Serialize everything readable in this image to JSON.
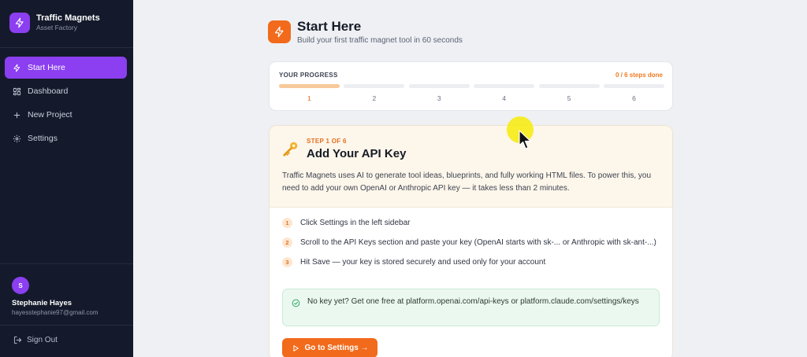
{
  "brand": {
    "name": "Traffic Magnets",
    "subtitle": "Asset Factory"
  },
  "sidebar": {
    "items": [
      {
        "label": "Start Here",
        "icon": "bolt-icon",
        "active": true
      },
      {
        "label": "Dashboard",
        "icon": "dashboard-icon",
        "active": false
      },
      {
        "label": "New Project",
        "icon": "plus-icon",
        "active": false
      },
      {
        "label": "Settings",
        "icon": "gear-icon",
        "active": false
      }
    ]
  },
  "user": {
    "initial": "S",
    "name": "Stephanie Hayes",
    "email": "hayesstephanie97@gmail.com",
    "signout_label": "Sign Out"
  },
  "header": {
    "title": "Start Here",
    "subtitle": "Build your first traffic magnet tool in 60 seconds"
  },
  "progress": {
    "label": "YOUR PROGRESS",
    "count": "0 / 6 steps done",
    "completed": 0,
    "total": 6,
    "current": 1,
    "steps": [
      "1",
      "2",
      "3",
      "4",
      "5",
      "6"
    ]
  },
  "step": {
    "kicker": "STEP 1 OF 6",
    "title": "Add Your API Key",
    "description": "Traffic Magnets uses AI to generate tool ideas, blueprints, and fully working HTML files. To power this, you need to add your own OpenAI or Anthropic API key — it takes less than 2 minutes.",
    "instructions": [
      {
        "num": "1",
        "text": "Click Settings in the left sidebar"
      },
      {
        "num": "2",
        "text": "Scroll to the API Keys section and paste your key (OpenAI starts with sk-... or Anthropic with sk-ant-...)"
      },
      {
        "num": "3",
        "text": "Hit Save — your key is stored securely and used only for your account"
      }
    ],
    "tip": "No key yet? Get one free at platform.openai.com/api-keys or platform.claude.com/settings/keys",
    "button_label": "Go to Settings →"
  },
  "colors": {
    "accent_purple": "#8b3ff0",
    "accent_orange": "#f26a1b",
    "sidebar_bg": "#141a2b"
  }
}
